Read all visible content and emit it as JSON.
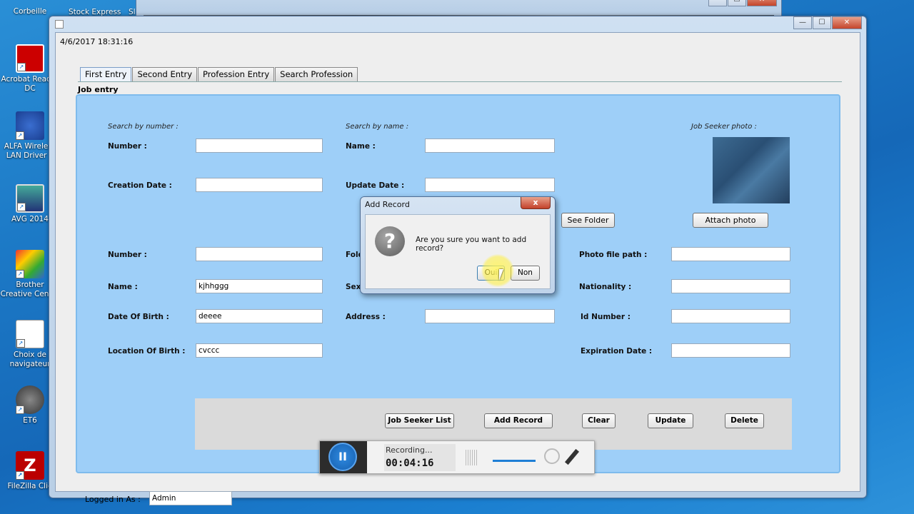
{
  "desktop_icons": [
    {
      "label": "Corbeille"
    },
    {
      "label": "Acrobat Reader DC"
    },
    {
      "label": "ALFA Wireless LAN Driver a"
    },
    {
      "label": "AVG 2014"
    },
    {
      "label": "Brother Creative Center"
    },
    {
      "label": "Choix de navigateur"
    },
    {
      "label": "ET6"
    },
    {
      "label": "FileZilla Clie"
    }
  ],
  "desktop_top_labels": [
    "Stock Express",
    "Sl"
  ],
  "main_window": {
    "datetime": "4/6/2017    18:31:16",
    "tabs": [
      "First Entry",
      "Second Entry",
      "Profession Entry",
      "Search Profession"
    ],
    "section_label": "Job entry",
    "search": {
      "by_number_hint": "Search by number :",
      "by_name_hint": "Search by name :",
      "photo_hint": "Job Seeker photo :",
      "number_label": "Number :",
      "name_label": "Name :",
      "creation_date_label": "Creation Date :",
      "update_date_label": "Update Date :"
    },
    "buttons": {
      "see_folder": "See Folder",
      "attach_photo": "Attach photo",
      "job_seeker_list": "Job Seeker List",
      "add_record": "Add Record",
      "clear": "Clear",
      "update": "Update",
      "delete": "Delete"
    },
    "form": {
      "number_label": "Number :",
      "name_label": "Name :",
      "name_value": "kjhhggg",
      "dob_label": "Date Of Birth :",
      "dob_value": "deeee",
      "lob_label": "Location Of Birth :",
      "lob_value": "cvccc",
      "folder_label": "Fold",
      "sex_label": "Sex",
      "address_label": "Address :",
      "photo_path_label": "Photo file path :",
      "nationality_label": "Nationality :",
      "id_number_label": "Id Number :",
      "expiration_label": "Expiration Date :"
    },
    "logged_in_label": "Logged in As :",
    "logged_in_value": "Admin"
  },
  "dialog": {
    "title": "Add Record",
    "message": "Are you sure you want to add record?",
    "yes": "Oui",
    "no": "Non",
    "close_glyph": "x",
    "icon_glyph": "?"
  },
  "recorder": {
    "status": "Recording...",
    "time": "00:04:16",
    "pause_glyph": "II"
  },
  "caption_glyphs": {
    "min": "—",
    "max": "☐",
    "close": "✕"
  }
}
